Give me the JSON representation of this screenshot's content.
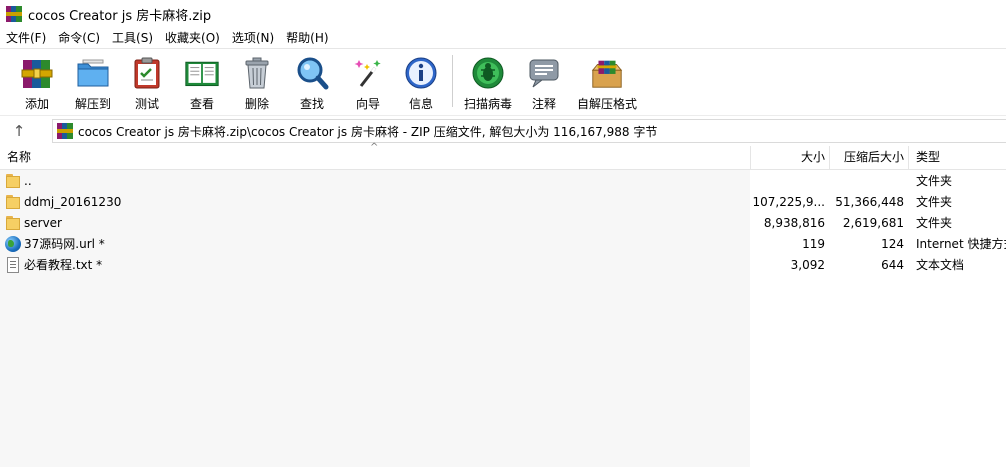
{
  "window": {
    "title": "cocos Creator js 房卡麻将.zip"
  },
  "menu": [
    "文件(F)",
    "命令(C)",
    "工具(S)",
    "收藏夹(O)",
    "选项(N)",
    "帮助(H)"
  ],
  "toolbar": {
    "add": "添加",
    "extract_to": "解压到",
    "test": "测试",
    "view": "查看",
    "delete": "删除",
    "find": "查找",
    "wizard": "向导",
    "info": "信息",
    "virus_scan": "扫描病毒",
    "comment": "注释",
    "sfx": "自解压格式"
  },
  "address": {
    "up_arrow": "↑",
    "path": "cocos Creator js 房卡麻将.zip\\cocos Creator js 房卡麻将 - ZIP 压缩文件, 解包大小为 116,167,988 字节"
  },
  "columns": {
    "name": "名称",
    "size": "大小",
    "packed": "压缩后大小",
    "type": "类型"
  },
  "files": [
    {
      "icon": "folder-icon",
      "name": "..",
      "size": "",
      "packed": "",
      "type": "文件夹"
    },
    {
      "icon": "folder-icon",
      "name": "ddmj_20161230",
      "size": "107,225,9...",
      "packed": "51,366,448",
      "type": "文件夹"
    },
    {
      "icon": "folder-icon",
      "name": "server",
      "size": "8,938,816",
      "packed": "2,619,681",
      "type": "文件夹"
    },
    {
      "icon": "globe-icon",
      "name": "37源码网.url *",
      "size": "119",
      "packed": "124",
      "type": "Internet 快捷方式"
    },
    {
      "icon": "text-file-icon",
      "name": "必看教程.txt *",
      "size": "3,092",
      "packed": "644",
      "type": "文本文档"
    }
  ]
}
